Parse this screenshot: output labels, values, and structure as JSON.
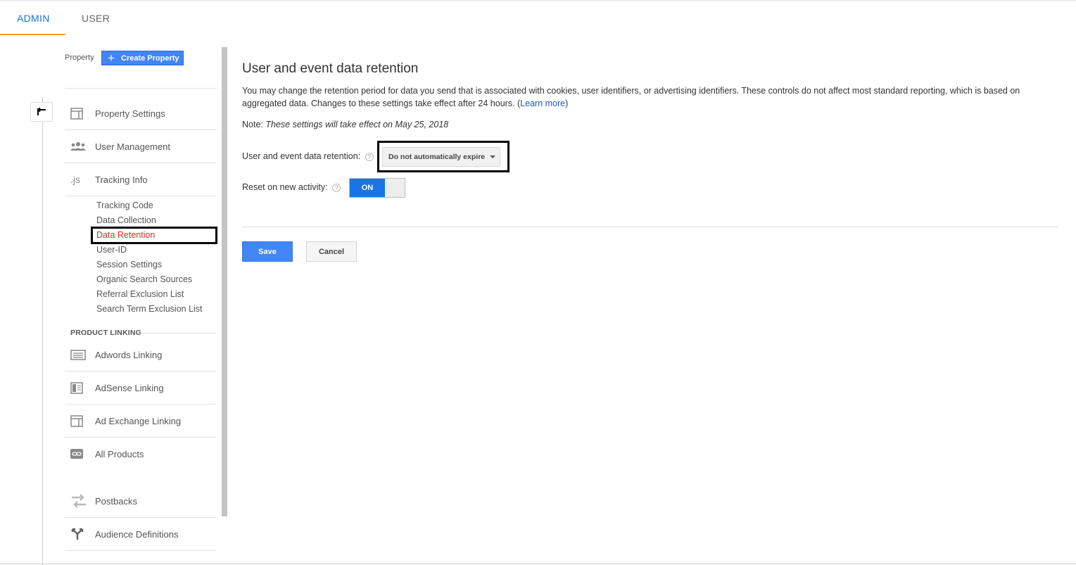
{
  "tabs": {
    "admin": "ADMIN",
    "user": "USER"
  },
  "sidebar": {
    "property_label": "Property",
    "create_property": "Create Property",
    "items": [
      {
        "label": "Property Settings",
        "icon": "property-settings-icon"
      },
      {
        "label": "User Management",
        "icon": "users-icon"
      },
      {
        "label": "Tracking Info",
        "icon": "js-icon"
      }
    ],
    "tracking_subitems": [
      "Tracking Code",
      "Data Collection",
      "Data Retention",
      "User-ID",
      "Session Settings",
      "Organic Search Sources",
      "Referral Exclusion List",
      "Search Term Exclusion List"
    ],
    "product_linking_heading": "PRODUCT LINKING",
    "linking_items": [
      {
        "label": "Adwords Linking",
        "icon": "adwords-icon"
      },
      {
        "label": "AdSense Linking",
        "icon": "adsense-icon"
      },
      {
        "label": "Ad Exchange Linking",
        "icon": "ad-exchange-icon"
      },
      {
        "label": "All Products",
        "icon": "link-icon"
      }
    ],
    "other_items": [
      {
        "label": "Postbacks",
        "icon": "postbacks-icon"
      },
      {
        "label": "Audience Definitions",
        "icon": "audience-icon"
      }
    ]
  },
  "main": {
    "title": "User and event data retention",
    "description": "You may change the retention period for data you send that is associated with cookies, user identifiers, or advertising identifiers. These controls do not affect most standard reporting, which is based on aggregated data. Changes to these settings take effect after 24 hours. (",
    "learn_more": "Learn more",
    "description_end": ")",
    "note_prefix": "Note: ",
    "note_text": "These settings will take effect on May 25, 2018",
    "retention_label": "User and event data retention:",
    "retention_value": "Do not automatically expire",
    "reset_label": "Reset on new activity:",
    "reset_toggle": "ON",
    "help_glyph": "?",
    "save": "Save",
    "cancel": "Cancel"
  },
  "colors": {
    "accent": "#4285f4",
    "tab_active": "#1a73e8",
    "tab_underline": "#f4a300",
    "active_link": "#d93025"
  }
}
